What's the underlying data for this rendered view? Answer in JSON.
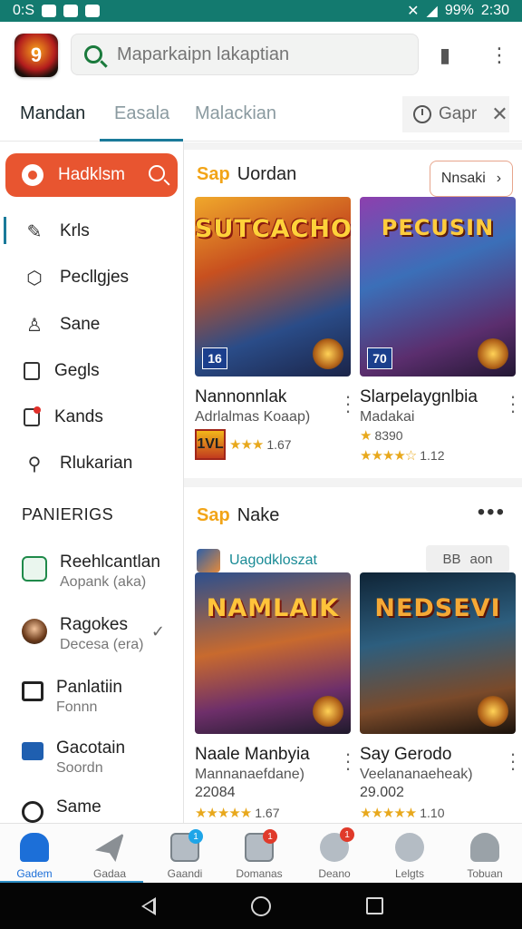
{
  "status_bar": {
    "time_left": "0:S",
    "battery": "99%",
    "time_right": "2:30"
  },
  "search": {
    "placeholder": "Maparkaipn lakaptian"
  },
  "tabs": [
    {
      "label": "Mandan"
    },
    {
      "label": "Easala"
    },
    {
      "label": "Malackian"
    }
  ],
  "tab_extra": {
    "label": "Gapr"
  },
  "sidebar": {
    "cta_label": "Hadklsm",
    "items": [
      {
        "label": "Krls",
        "icon": "edit-icon"
      },
      {
        "label": "Pecllgjes",
        "icon": "box-icon"
      },
      {
        "label": "Sane",
        "icon": "person-icon"
      },
      {
        "label": "Gegls",
        "icon": "tablet-icon"
      },
      {
        "label": "Kands",
        "icon": "notice-icon"
      },
      {
        "label": "Rlukarian",
        "icon": "search-icon"
      }
    ],
    "heading": "PANIERIGS",
    "games": [
      {
        "name": "Reehlcantlan",
        "sub": "Aopank (aka)",
        "icon": "shield-icon"
      },
      {
        "name": "Ragokes",
        "sub": "Decesa (era)",
        "icon": "avatar-icon"
      },
      {
        "name": "Panlatiin",
        "sub": "Fonnn",
        "icon": "browser-icon"
      },
      {
        "name": "Gacotain",
        "sub": "Soordn",
        "icon": "game-icon"
      },
      {
        "name": "Same",
        "sub": "",
        "icon": "target-icon"
      }
    ]
  },
  "sections": [
    {
      "title_highlight": "Sap",
      "title": "Uordan",
      "more_label": "Nnsaki",
      "cards": [
        {
          "art_title": "SUTCACHOS",
          "name": "Nannonnlak",
          "sub": "Adrlalmas Koaap)",
          "rating": "1.67",
          "badge": "16",
          "age": "1VL"
        },
        {
          "art_title": "PECUSIN",
          "name": "Slarpelaygnlbia",
          "sub": "Madakai",
          "price": "8390",
          "rating": "1.12",
          "badge": "70"
        }
      ]
    },
    {
      "title_highlight": "Sap",
      "title": "Nake",
      "developer": "Uagodkloszat",
      "pill_label": "BB",
      "pill_extra": "aon",
      "cards": [
        {
          "art_title": "NAMLAIK",
          "name": "Naale Manbyia",
          "sub": "Mannanaefdane)",
          "price": "22084",
          "rating": "1.67"
        },
        {
          "art_title": "NEDSEVI",
          "name": "Say Gerodo",
          "sub": "Veelananaeheak)",
          "price": "29.002",
          "rating": "1.10"
        }
      ]
    }
  ],
  "bottom_nav": [
    {
      "label": "Gadem",
      "icon": "home-icon"
    },
    {
      "label": "Gadaa",
      "icon": "send-icon"
    },
    {
      "label": "Gaandi",
      "icon": "library-icon",
      "badge": "1"
    },
    {
      "label": "Domanas",
      "icon": "grid-icon",
      "badge": "1"
    },
    {
      "label": "Deano",
      "icon": "chat-icon",
      "badge": "1"
    },
    {
      "label": "Lelgts",
      "icon": "gauge-icon"
    },
    {
      "label": "Tobuan",
      "icon": "profile-icon"
    }
  ],
  "colors": {
    "accent": "#1a7a9a",
    "cta": "#e85530",
    "status_bar": "#137a6f",
    "star": "#e8a81c"
  }
}
